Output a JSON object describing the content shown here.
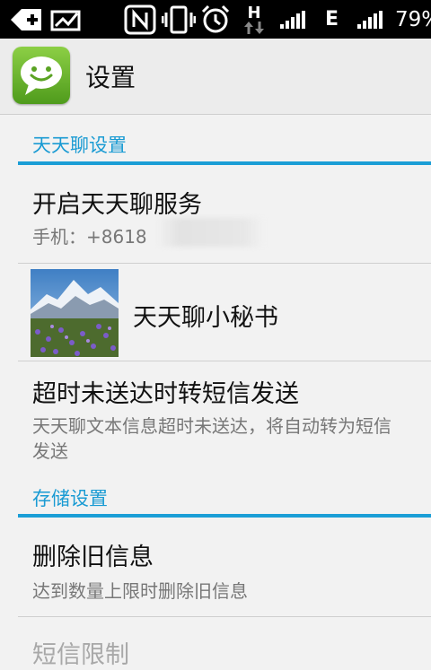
{
  "status_bar": {
    "network_type": "H",
    "network_type2": "E",
    "battery": "79%"
  },
  "action_bar": {
    "title": "设置"
  },
  "sections": [
    {
      "label": "天天聊设置"
    },
    {
      "label": "存储设置"
    }
  ],
  "items": {
    "enable_service": {
      "title": "开启天天聊服务",
      "subtitle": "手机：+8618"
    },
    "secretary": {
      "title": "天天聊小秘书"
    },
    "sms_fallback": {
      "title": "超时未送达时转短信发送",
      "subtitle_line1": "天天聊文本信息超时未送达，将自动转为短信",
      "subtitle_line2": "发送"
    },
    "delete_old": {
      "title": "删除旧信息",
      "subtitle": "达到数量上限时删除旧信息"
    },
    "sms_limit": {
      "title": "短信限制"
    }
  }
}
